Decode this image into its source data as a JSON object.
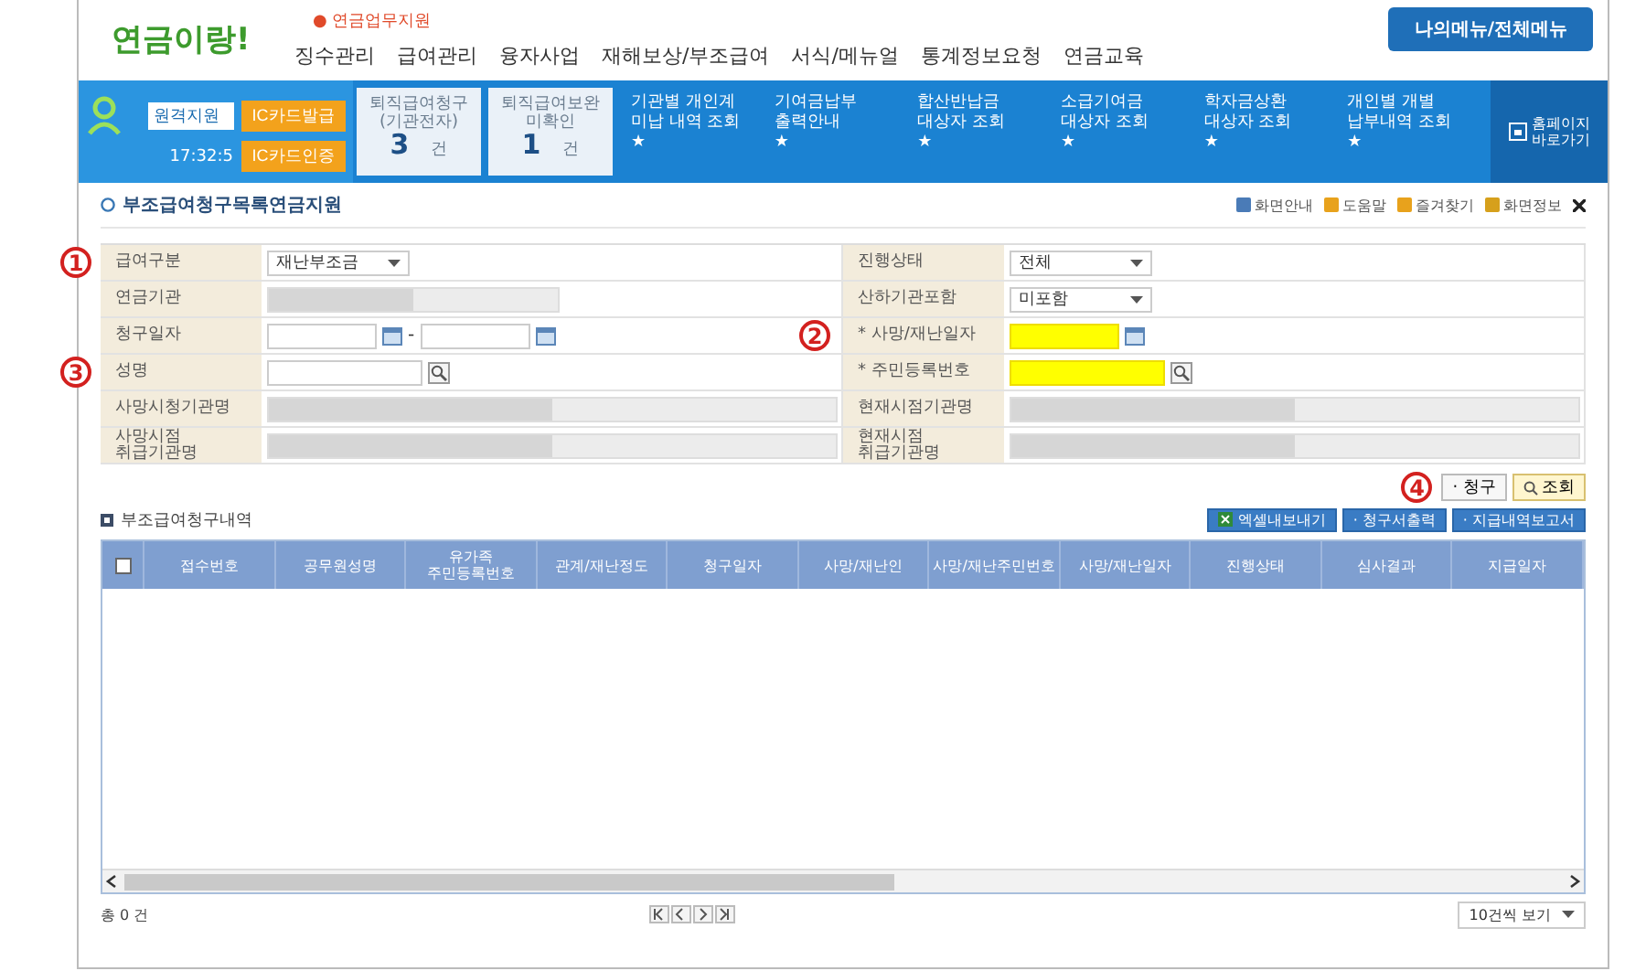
{
  "header": {
    "logo": "연금이랑!",
    "notice": "● 연금업무지원",
    "nav": [
      "징수관리",
      "급여관리",
      "융자사업",
      "재해보상/부조급여",
      "서식/메뉴얼",
      "통계정보요청",
      "연금교육"
    ],
    "menu_button": "나의메뉴/전체메뉴"
  },
  "user_panel": {
    "role": "원격지원",
    "buttons": [
      "IC카드발급",
      "IC카드인증"
    ],
    "time": "17:32:5"
  },
  "counters": [
    {
      "label": "퇴직급여청구\n(기관전자)",
      "count": "3",
      "unit": "건"
    },
    {
      "label": "퇴직급여보완\n미확인",
      "count": "1",
      "unit": "건"
    }
  ],
  "quick_links": [
    {
      "label": "기관별 개인계\n미납 내역 조회",
      "star": "★"
    },
    {
      "label": "기여금납부\n출력안내",
      "star": "★"
    },
    {
      "label": "합산반납금\n대상자 조회",
      "star": "★"
    },
    {
      "label": "소급기여금\n대상자 조회",
      "star": "★"
    },
    {
      "label": "학자금상환\n대상자 조회",
      "star": "★"
    },
    {
      "label": "개인별 개별\n납부내역 조회",
      "star": "★"
    }
  ],
  "homepage_link": "홈페이지\n바로가기",
  "page_title": "부조급여청구목록연금지원",
  "page_tools": [
    "화면안내",
    "도움말",
    "즐겨찾기",
    "화면정보"
  ],
  "form": {
    "left": [
      {
        "label": "급여구분",
        "kind": "select",
        "value": "재난부조금",
        "marker": "1"
      },
      {
        "label": "연금기관",
        "kind": "readonly"
      },
      {
        "label": "청구일자",
        "kind": "date-range",
        "separator": "-"
      },
      {
        "label": "성명",
        "kind": "search",
        "marker": "3"
      },
      {
        "label": "사망시청기관명",
        "kind": "readonly-wide"
      },
      {
        "label": "사망시점\n취급기관명",
        "kind": "readonly-wide"
      }
    ],
    "right": [
      {
        "label": "진행상태",
        "kind": "select",
        "value": "전체"
      },
      {
        "label": "산하기관포함",
        "kind": "select",
        "value": "미포함"
      },
      {
        "label": "* 사망/재난일자",
        "kind": "date",
        "highlighted": true,
        "marker": "2"
      },
      {
        "label": "* 주민등록번호",
        "kind": "search",
        "highlighted": true
      },
      {
        "label": "현재시점기관명",
        "kind": "readonly-wide"
      },
      {
        "label": "현재시점\n취급기관명",
        "kind": "readonly-wide"
      }
    ]
  },
  "action_marker": "4",
  "actions": [
    {
      "label": "· 청구",
      "kind": "plain"
    },
    {
      "label": "조회",
      "kind": "search"
    }
  ],
  "grid": {
    "title": "부조급여청구내역",
    "buttons": [
      {
        "label": "엑셀내보내기",
        "kind": "excel"
      },
      {
        "label": "· 청구서출력",
        "kind": "plain"
      },
      {
        "label": "· 지급내역보고서",
        "kind": "plain"
      }
    ],
    "select_all_checked": false,
    "columns": [
      "접수번호",
      "공무원성명",
      "유가족\n주민등록번호",
      "관계/재난정도",
      "청구일자",
      "사망/재난인",
      "사망/재난주민번호",
      "사망/재난일자",
      "진행상태",
      "심사결과",
      "지급일자"
    ],
    "total": "총 0 건",
    "page_size": "10건씩 보기"
  }
}
